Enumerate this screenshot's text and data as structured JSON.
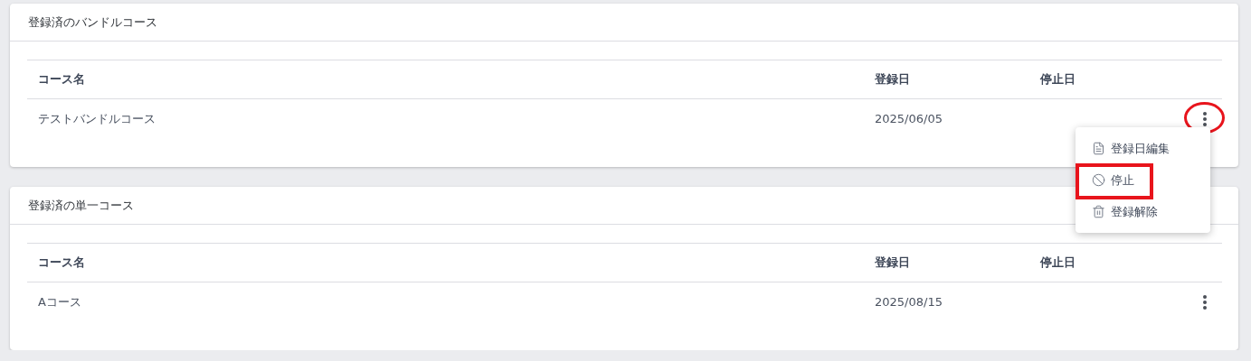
{
  "sections": [
    {
      "title": "登録済のバンドルコース",
      "columns": [
        "コース名",
        "登録日",
        "停止日"
      ],
      "rows": [
        {
          "name": "テストバンドルコース",
          "registered": "2025/06/05",
          "menu_open": true,
          "annotated": true,
          "menu": [
            {
              "kind": "edit",
              "label": "登録日編集",
              "annotated": false
            },
            {
              "kind": "stop",
              "label": "停止",
              "annotated": true
            },
            {
              "kind": "delete",
              "label": "登録解除",
              "annotated": false
            }
          ]
        }
      ]
    },
    {
      "title": "登録済の単一コース",
      "columns": [
        "コース名",
        "登録日",
        "停止日"
      ],
      "rows": [
        {
          "name": "Aコース",
          "registered": "2025/08/15",
          "menu_open": false,
          "annotated": false
        }
      ]
    }
  ]
}
